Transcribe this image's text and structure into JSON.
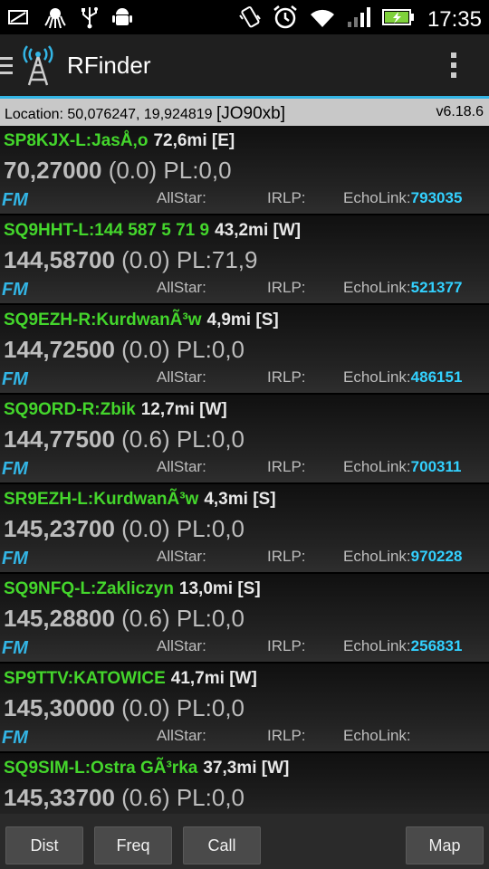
{
  "status_bar": {
    "time": "17:35"
  },
  "app": {
    "title": "RFinder"
  },
  "location": {
    "prefix": "Location: 50,076247, 19,924819 ",
    "grid": "[JO90xb]",
    "version": "v6.18.6"
  },
  "labels": {
    "allstar": "AllStar:",
    "irlp": "IRLP:",
    "echolink": "EchoLink:"
  },
  "repeaters": [
    {
      "call": "SP8KJX-L:JasÅ‚o",
      "dist": "72,6mi [E]",
      "freq": "70,27000",
      "offset": "(0.0)",
      "pl": "PL:0,0",
      "mode": "FM",
      "echolink": "793035"
    },
    {
      "call": "SQ9HHT-L:144 587 5 71 9",
      "dist": "43,2mi [W]",
      "freq": "144,58700",
      "offset": "(0.0)",
      "pl": "PL:71,9",
      "mode": "FM",
      "echolink": "521377"
    },
    {
      "call": "SQ9EZH-R:KurdwanÃ³w",
      "dist": "4,9mi [S]",
      "freq": "144,72500",
      "offset": "(0.0)",
      "pl": "PL:0,0",
      "mode": "FM",
      "echolink": "486151"
    },
    {
      "call": "SQ9ORD-R:Zbik",
      "dist": "12,7mi [W]",
      "freq": "144,77500",
      "offset": "(0.6)",
      "pl": "PL:0,0",
      "mode": "FM",
      "echolink": "700311"
    },
    {
      "call": "SR9EZH-L:KurdwanÃ³w",
      "dist": "4,3mi [S]",
      "freq": "145,23700",
      "offset": "(0.0)",
      "pl": "PL:0,0",
      "mode": "FM",
      "echolink": "970228"
    },
    {
      "call": "SQ9NFQ-L:Zakliczyn",
      "dist": "13,0mi [S]",
      "freq": "145,28800",
      "offset": "(0.6)",
      "pl": "PL:0,0",
      "mode": "FM",
      "echolink": "256831"
    },
    {
      "call": "SP9TTV:KATOWICE",
      "dist": "41,7mi [W]",
      "freq": "145,30000",
      "offset": "(0.0)",
      "pl": "PL:0,0",
      "mode": "FM",
      "echolink": ""
    },
    {
      "call": "SQ9SIM-L:Ostra GÃ³rka",
      "dist": "37,3mi [W]",
      "freq": "145,33700",
      "offset": "(0.6)",
      "pl": "PL:0,0",
      "mode": "",
      "echolink": ""
    }
  ],
  "buttons": {
    "dist": "Dist",
    "freq": "Freq",
    "call": "Call",
    "map": "Map"
  }
}
